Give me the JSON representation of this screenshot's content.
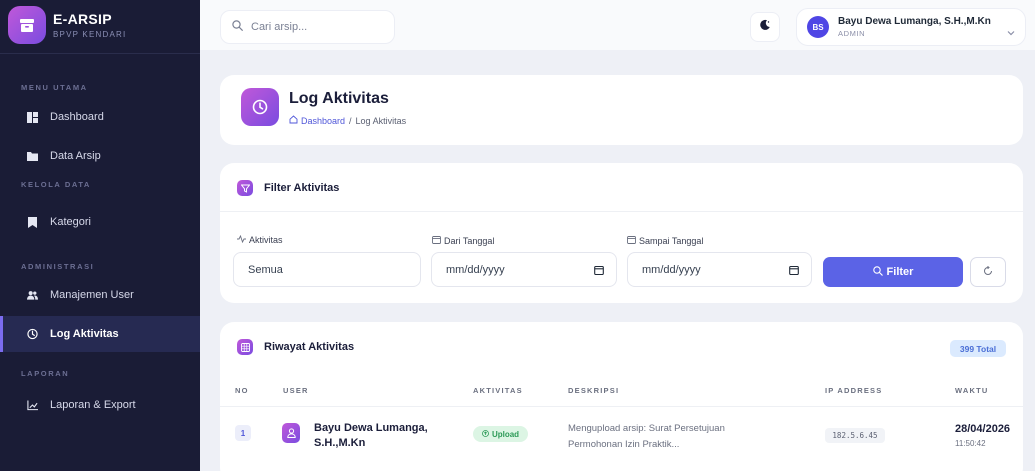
{
  "sidebar": {
    "brand_title": "E-ARSIP",
    "brand_subtitle": "BPVP KENDARI",
    "sections": {
      "menu_utama": "MENU UTAMA",
      "kelola_data": "KELOLA DATA",
      "administrasi": "ADMINISTRASI",
      "laporan": "LAPORAN"
    },
    "items": {
      "dashboard": "Dashboard",
      "data_arsip": "Data Arsip",
      "kategori": "Kategori",
      "manajemen_user": "Manajemen User",
      "log_aktivitas": "Log Aktivitas",
      "laporan_export": "Laporan & Export"
    },
    "active_item": "log_aktivitas"
  },
  "topbar": {
    "search_placeholder": "Cari arsip...",
    "user_initials": "BS",
    "user_name": "Bayu Dewa Lumanga, S.H.,M.Kn",
    "user_role": "ADMIN"
  },
  "page": {
    "title": "Log Aktivitas",
    "breadcrumb_home": "Dashboard",
    "breadcrumb_sep": "/",
    "breadcrumb_current": "Log Aktivitas"
  },
  "filter": {
    "title": "Filter Aktivitas",
    "label_aktivitas": "Aktivitas",
    "label_dari": "Dari Tanggal",
    "label_sampai": "Sampai Tanggal",
    "value_aktivitas": "Semua",
    "value_dari": "mm/dd/yyyy",
    "value_sampai": "mm/dd/yyyy",
    "filter_button": "Filter"
  },
  "riwayat": {
    "title": "Riwayat Aktivitas",
    "total_badge": "399 Total",
    "columns": [
      "NO",
      "USER",
      "AKTIVITAS",
      "DESKRIPSI",
      "IP ADDRESS",
      "WAKTU"
    ],
    "rows": [
      {
        "no": "1",
        "user_line1": "Bayu Dewa Lumanga,",
        "user_line2": "S.H.,M.Kn",
        "aktivitas": "Upload",
        "desc_line1": "Mengupload arsip: Surat Persetujuan",
        "desc_line2": "Permohonan Izin Praktik...",
        "ip": "182.5.6.45",
        "date": "28/04/2026",
        "time": "11:50:42"
      }
    ]
  },
  "colors": {
    "sidebar_bg": "#1a1c36",
    "accent": "#5b63e6",
    "brand_gradient_start": "#c058d9",
    "brand_gradient_end": "#7a4ce0",
    "success": "#2c9a57"
  }
}
